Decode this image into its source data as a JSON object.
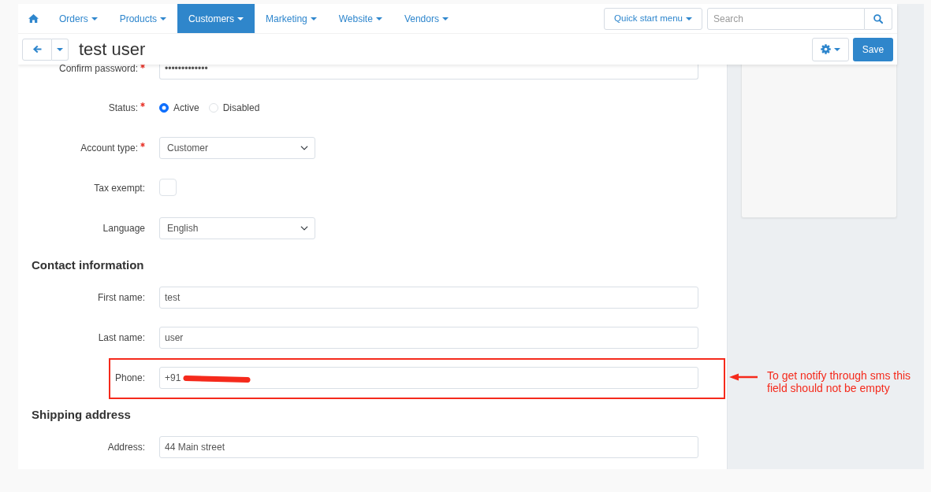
{
  "top_nav": {
    "items": [
      {
        "kind": "home",
        "selected": false
      },
      {
        "kind": "menu",
        "label": "Orders",
        "selected": false
      },
      {
        "kind": "menu",
        "label": "Products",
        "selected": false
      },
      {
        "kind": "menu",
        "label": "Customers",
        "selected": true
      },
      {
        "kind": "menu",
        "label": "Marketing",
        "selected": false
      },
      {
        "kind": "menu",
        "label": "Website",
        "selected": false
      },
      {
        "kind": "menu",
        "label": "Vendors",
        "selected": false
      }
    ],
    "quick_start_menu": {
      "label": "Quick start menu"
    },
    "search": {
      "placeholder": "Search"
    }
  },
  "toolbar": {
    "title": "test user",
    "save_button": {
      "label": "Save"
    }
  },
  "form": {
    "sections": [
      {
        "rows": [
          {
            "kind": "text",
            "label": "Confirm password:",
            "required": true,
            "value": "•••••••••••••",
            "redacted": false
          },
          {
            "kind": "radio",
            "label": "Status:",
            "required": true,
            "options": [
              {
                "label": "Active",
                "selected": true
              },
              {
                "label": "Disabled",
                "selected": false
              }
            ]
          },
          {
            "kind": "select",
            "label": "Account type:",
            "required": true,
            "value": "Customer"
          },
          {
            "kind": "checkbox",
            "label": "Tax exempt:",
            "required": false,
            "checked": false
          },
          {
            "kind": "select",
            "label": "Language",
            "required": false,
            "value": "English"
          }
        ]
      },
      {
        "heading": "Contact information",
        "rows": [
          {
            "kind": "text",
            "label": "First name:",
            "required": false,
            "value": "test",
            "redacted": false
          },
          {
            "kind": "text",
            "label": "Last name:",
            "required": false,
            "value": "user",
            "redacted": false
          },
          {
            "kind": "text",
            "label": "Phone:",
            "required": false,
            "value": "+91",
            "redacted": true,
            "annotation": "To get notify through sms this field should not be empty"
          }
        ]
      },
      {
        "heading": "Shipping address",
        "rows": [
          {
            "kind": "text",
            "label": "Address:",
            "required": false,
            "value": "44 Main street",
            "redacted": false
          }
        ]
      }
    ]
  }
}
